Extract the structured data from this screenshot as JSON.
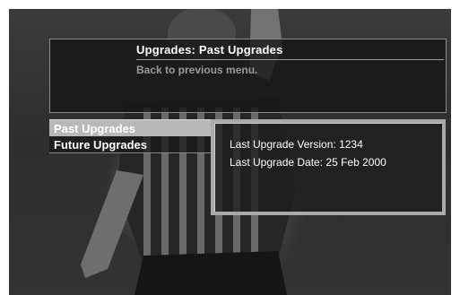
{
  "header": {
    "title": "Upgrades: Past Upgrades",
    "back_label": "Back to previous menu."
  },
  "menu": {
    "items": [
      {
        "label": "Past Upgrades",
        "selected": true
      },
      {
        "label": "Future Upgrades",
        "selected": false
      }
    ]
  },
  "info": {
    "version_line": "Last Upgrade Version: 1234",
    "date_line": "Last Upgrade Date: 25 Feb 2000"
  },
  "colors": {
    "selected_item": "#b8b8b8",
    "panel_border": "#aaaaaa",
    "dim_text": "#9a9a9a"
  }
}
